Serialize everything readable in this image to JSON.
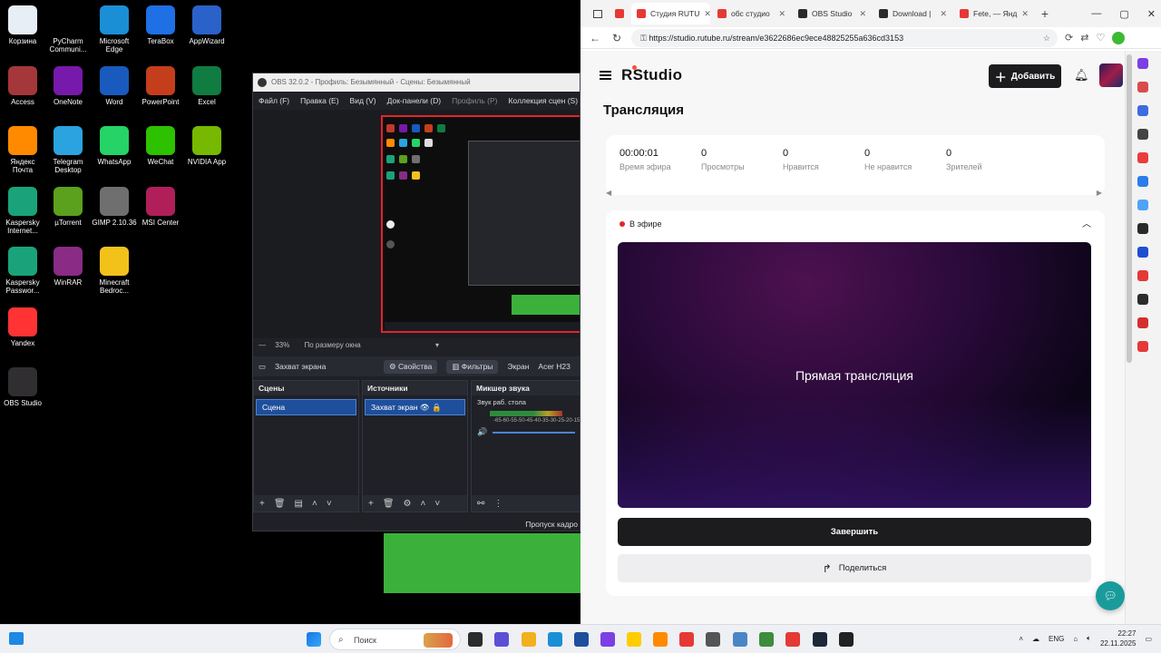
{
  "desktop": {
    "icons": [
      {
        "label": "Корзина",
        "icon": "recycle-bin-icon",
        "color": "#ffffff"
      },
      {
        "label": "PyCharm Communi...",
        "icon": "pycharm-icon",
        "color": "#000000"
      },
      {
        "label": "Microsoft Edge",
        "icon": "edge-icon",
        "color": "#1b8fd6"
      },
      {
        "label": "TeraBox",
        "icon": "terabox-icon",
        "color": "#1f6fe5"
      },
      {
        "label": "AppWizard",
        "icon": "appwizard-icon",
        "color": "#2a62c9"
      },
      {
        "label": "Access",
        "icon": "access-icon",
        "color": "#a4373a"
      },
      {
        "label": "OneNote",
        "icon": "onenote-icon",
        "color": "#7719aa"
      },
      {
        "label": "Word",
        "icon": "word-icon",
        "color": "#185abd"
      },
      {
        "label": "PowerPoint",
        "icon": "powerpoint-icon",
        "color": "#c43e1c"
      },
      {
        "label": "Excel",
        "icon": "excel-icon",
        "color": "#107c41"
      },
      {
        "label": "Яндекс Почта",
        "icon": "yandex-mail-icon",
        "color": "#ff8a00"
      },
      {
        "label": "Telegram Desktop",
        "icon": "telegram-icon",
        "color": "#2aa3e0"
      },
      {
        "label": "WhatsApp",
        "icon": "whatsapp-icon",
        "color": "#25d366"
      },
      {
        "label": "WeChat",
        "icon": "wechat-icon",
        "color": "#2dc100"
      },
      {
        "label": "NVIDIA App",
        "icon": "nvidia-icon",
        "color": "#76b900"
      },
      {
        "label": "Kaspersky Internet...",
        "icon": "kaspersky-icon",
        "color": "#1aa37a"
      },
      {
        "label": "µTorrent",
        "icon": "utorrent-icon",
        "color": "#5ba11d"
      },
      {
        "label": "GIMP 2.10.36",
        "icon": "gimp-icon",
        "color": "#6f6f6f"
      },
      {
        "label": "MSI Center",
        "icon": "msi-center-icon",
        "color": "#b01f5a"
      },
      {
        "label": "Kaspersky Passwor...",
        "icon": "kaspersky-password-icon",
        "color": "#1aa37a"
      },
      {
        "label": "WinRAR",
        "icon": "winrar-icon",
        "color": "#8a2b86"
      },
      {
        "label": "Minecraft Bedroc...",
        "icon": "minecraft-icon",
        "color": "#f2c21b"
      },
      {
        "label": "Yandex",
        "icon": "yandex-browser-icon",
        "color": "#ff3333"
      },
      {
        "label": "OBS Studio",
        "icon": "obs-icon",
        "color": "#302e31"
      }
    ]
  },
  "obs": {
    "title": "OBS 32.0.2 - Профиль: Безымянный - Сцены: Безымянный",
    "menu": [
      "Файл (F)",
      "Правка (E)",
      "Вид (V)",
      "Док-панели (D)",
      "Профиль (P)",
      "Коллекция сцен (S)"
    ],
    "zoom": "33%",
    "fit": "По размеру окна",
    "source_name": "Захват экрана",
    "properties": "Свойства",
    "filters": "Фильтры",
    "screen_label": "Экран",
    "device_label": "Acer H23",
    "scenes_title": "Сцены",
    "scene_item": "Сцена",
    "sources_title": "Источники",
    "source_item": "Захват экран",
    "mixer_title": "Микшер звука",
    "mixer_item": "Звук раб. стола",
    "mixer_scale": "-65-60-55-50-45-40-35-30-25-20-15",
    "status": "Пропуск кадро"
  },
  "browser": {
    "tabs": [
      {
        "label": "Студия RUTU",
        "color": "#e53935",
        "active": true
      },
      {
        "label": "обс студио",
        "color": "#e53935",
        "active": false
      },
      {
        "label": "OBS Studio",
        "color": "#2b2b2b",
        "active": false
      },
      {
        "label": "Download |",
        "color": "#2b2b2b",
        "active": false
      },
      {
        "label": "Fete, — Янд",
        "color": "#e53935",
        "active": false
      }
    ],
    "url": "https://studio.rutube.ru/stream/e3622686ec9ece48825255a636cd3153"
  },
  "page": {
    "logo_r": "R",
    "logo_text": "Studio",
    "add_label": "Добавить",
    "title": "Трансляция",
    "stats": [
      {
        "value": "00:00:01",
        "label": "Время эфира"
      },
      {
        "value": "0",
        "label": "Просмотры"
      },
      {
        "value": "0",
        "label": "Нравится"
      },
      {
        "value": "0",
        "label": "Не нравится"
      },
      {
        "value": "0",
        "label": "Зрителей"
      }
    ],
    "live_label": "В эфире",
    "player_text": "Прямая трансляция",
    "end_label": "Завершить",
    "share_label": "Поделиться"
  },
  "taskbar": {
    "search": "Поиск",
    "lang": "ENG",
    "time": "22:27",
    "date": "22.11.2025"
  },
  "colors": {
    "accent_dark": "#1c1c1e",
    "live_red": "#e42525",
    "help_teal": "#1a9b9b"
  }
}
